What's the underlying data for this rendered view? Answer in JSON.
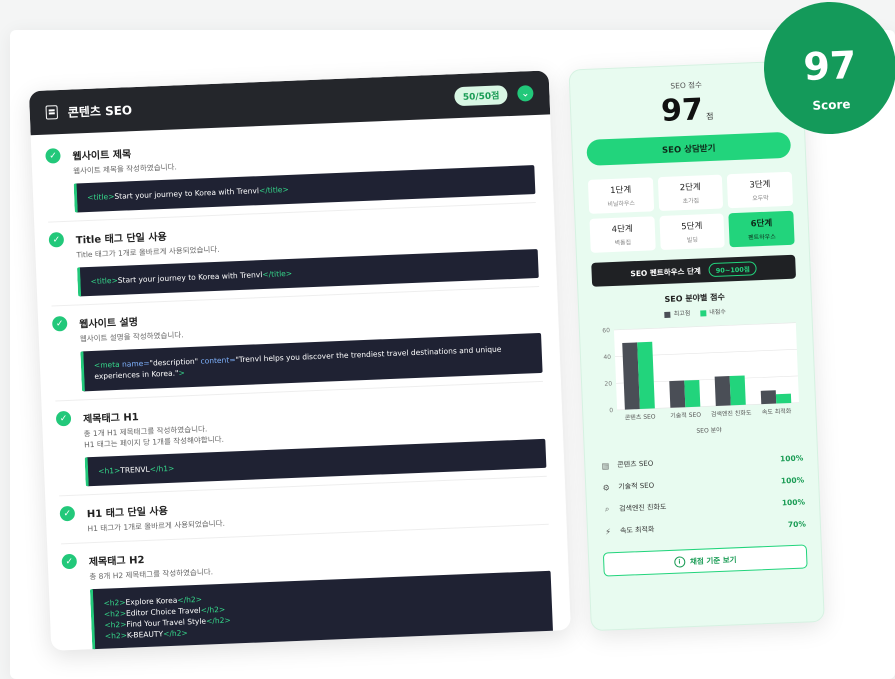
{
  "colors": {
    "accent": "#22d47c",
    "dark": "#24262b",
    "badge": "#149a5a",
    "bar_dark": "#4a4e56"
  },
  "header": {
    "title": "콘텐츠 SEO",
    "points": "50/50점"
  },
  "items": [
    {
      "title": "웹사이트 제목",
      "desc": "웹사이트 제목을 작성하였습니다.",
      "code": [
        [
          [
            "t",
            "<title>"
          ],
          [
            "s",
            "Start your journey to Korea with Trenvl"
          ],
          [
            "t",
            "</title>"
          ]
        ]
      ]
    },
    {
      "title": "Title 태그 단일 사용",
      "desc": "Title 태그가 1개로 올바르게 사용되었습니다.",
      "code": [
        [
          [
            "t",
            "<title>"
          ],
          [
            "s",
            "Start your journey to Korea with Trenvl"
          ],
          [
            "t",
            "</title>"
          ]
        ]
      ]
    },
    {
      "title": "웹사이트 설명",
      "desc": "웹사이트 설명을 작성하였습니다.",
      "code": [
        [
          [
            "t",
            "<meta "
          ],
          [
            "a",
            "name="
          ],
          [
            "s",
            "\"description\" "
          ],
          [
            "a",
            "content="
          ],
          [
            "s",
            "\"Trenvl helps you discover the trendiest travel destinations and unique experiences in Korea.\""
          ],
          [
            "t",
            ">"
          ]
        ]
      ]
    },
    {
      "title": "제목태그 H1",
      "desc": "총 1개 H1 제목태그를 작성하였습니다.",
      "desc2": "H1 태그는 페이지 당 1개를 작성해야합니다.",
      "code": [
        [
          [
            "t",
            "<h1>"
          ],
          [
            "s",
            "TRENVL"
          ],
          [
            "t",
            "</h1>"
          ]
        ]
      ]
    },
    {
      "title": "H1 태그 단일 사용",
      "desc": "H1 태그가 1개로 올바르게 사용되었습니다."
    },
    {
      "title": "제목태그 H2",
      "desc": "총 8개 H2 제목태그를 작성하였습니다.",
      "code": [
        [
          [
            "t",
            "<h2>"
          ],
          [
            "s",
            "Explore Korea"
          ],
          [
            "t",
            "</h2>"
          ]
        ],
        [
          [
            "t",
            "<h2>"
          ],
          [
            "s",
            "Editor Choice Travel"
          ],
          [
            "t",
            "</h2>"
          ]
        ],
        [
          [
            "t",
            "<h2>"
          ],
          [
            "s",
            "Find Your Travel Style"
          ],
          [
            "t",
            "</h2>"
          ]
        ],
        [
          [
            "t",
            "<h2>"
          ],
          [
            "s",
            "K-BEAUTY"
          ],
          [
            "t",
            "</h2>"
          ]
        ]
      ]
    }
  ],
  "score": {
    "label": "SEO 점수",
    "value": "97",
    "unit": "점",
    "consult": "SEO 상담받기"
  },
  "steps": [
    {
      "name": "1단계",
      "sub": "비닐하우스"
    },
    {
      "name": "2단계",
      "sub": "초가집"
    },
    {
      "name": "3단계",
      "sub": "오두막"
    },
    {
      "name": "4단계",
      "sub": "벽돌집"
    },
    {
      "name": "5단계",
      "sub": "빌딩"
    },
    {
      "name": "6단계",
      "sub": "펜트하우스",
      "active": true
    }
  ],
  "stage": {
    "label": "SEO 펜트하우스 단계",
    "range": "90~100점"
  },
  "chart_data": {
    "type": "bar",
    "title": "SEO 분야별 점수",
    "xlabel": "SEO 분야",
    "ylabel": "",
    "ylim": [
      0,
      60
    ],
    "yticks": [
      0,
      20,
      40,
      60
    ],
    "categories": [
      "콘텐츠 SEO",
      "기술적 SEO",
      "검색엔진 친화도",
      "속도 최적화"
    ],
    "series": [
      {
        "name": "최고점",
        "values": [
          50,
          20,
          22,
          10
        ],
        "color": "#4a4e56"
      },
      {
        "name": "내점수",
        "values": [
          50,
          20,
          22,
          7
        ],
        "color": "#22d47c"
      }
    ],
    "grid": true,
    "legend": "top-center"
  },
  "fields": [
    {
      "icon": "doc",
      "label": "콘텐츠 SEO",
      "pct": "100%"
    },
    {
      "icon": "gear",
      "label": "기술적 SEO",
      "pct": "100%"
    },
    {
      "icon": "search",
      "label": "검색엔진 친화도",
      "pct": "100%"
    },
    {
      "icon": "bolt",
      "label": "속도 최적화",
      "pct": "70%"
    }
  ],
  "criteria": "채점 기준 보기",
  "badge": {
    "value": "97",
    "label": "Score"
  }
}
